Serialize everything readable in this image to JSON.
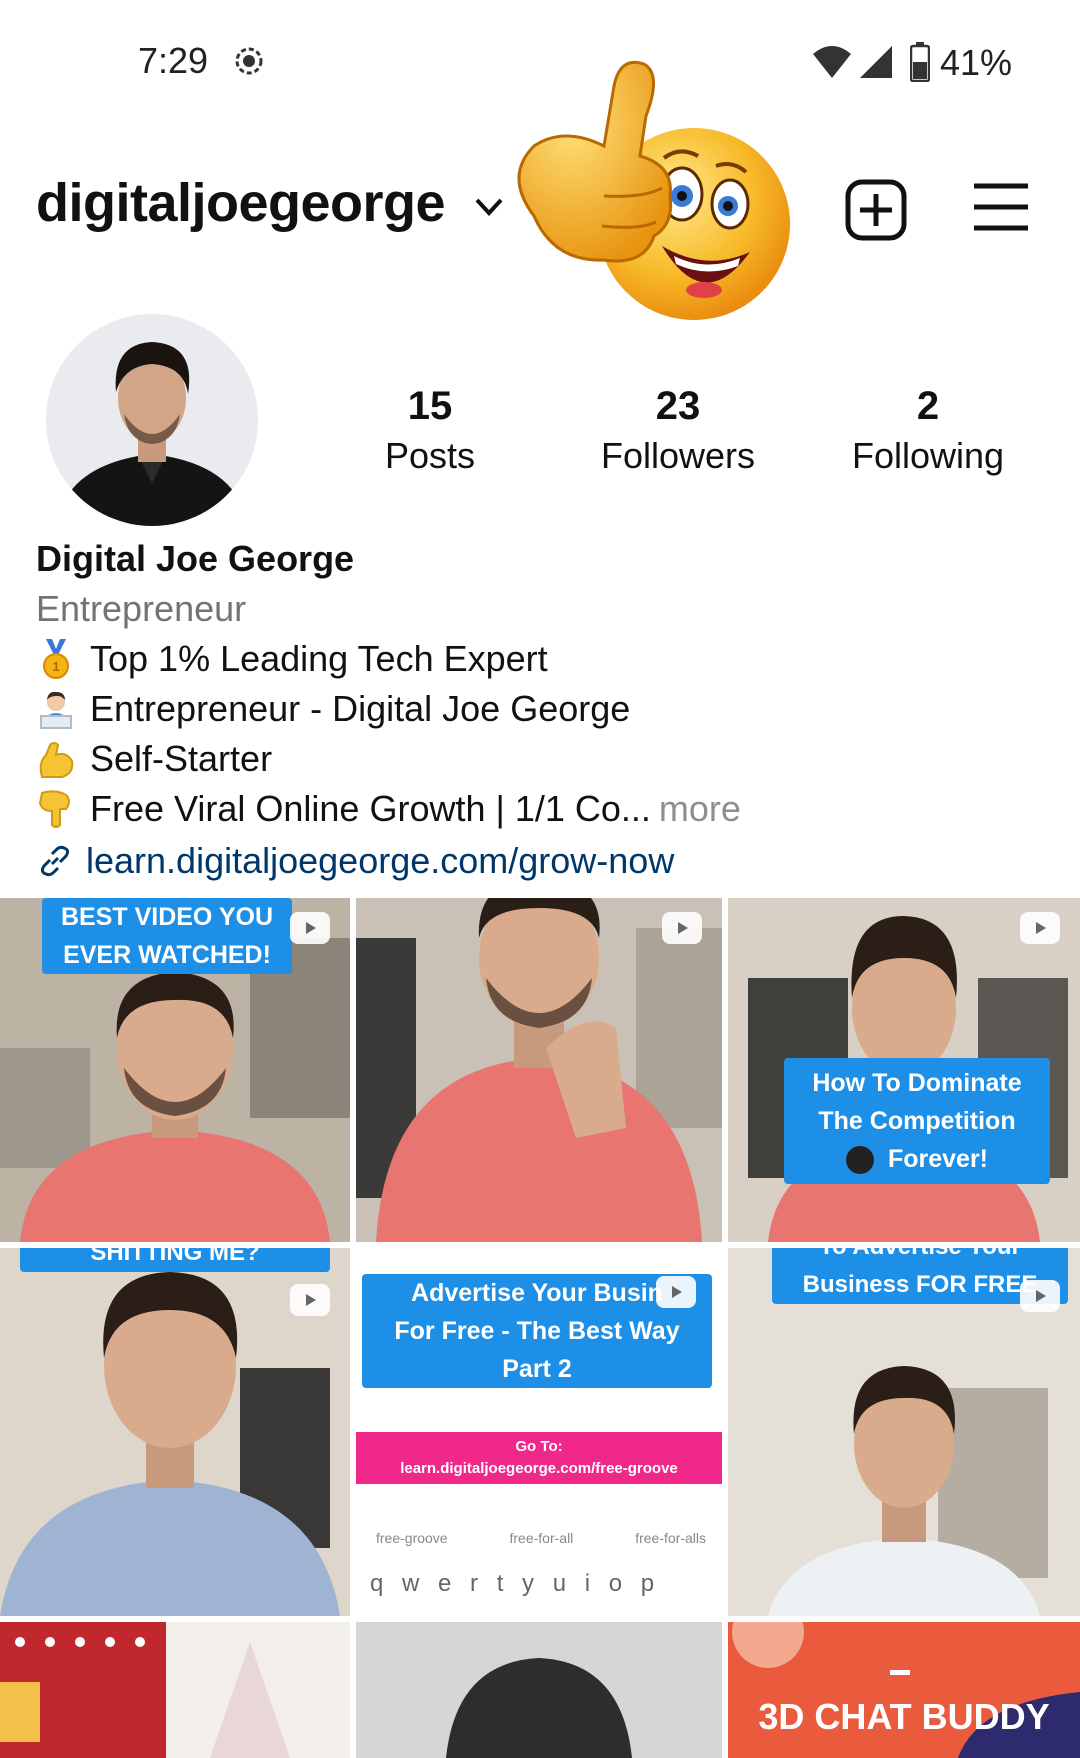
{
  "status_bar": {
    "time": "7:29",
    "battery": "41%"
  },
  "header": {
    "username": "digitaljoegeorge"
  },
  "profile": {
    "stats": [
      {
        "value": "15",
        "label": "Posts"
      },
      {
        "value": "23",
        "label": "Followers"
      },
      {
        "value": "2",
        "label": "Following"
      }
    ],
    "name": "Digital Joe George",
    "category": "Entrepreneur",
    "bio": [
      {
        "icon": "medal-icon",
        "text": "Top 1% Leading Tech Expert"
      },
      {
        "icon": "technologist-icon",
        "text": "Entrepreneur - Digital Joe George"
      },
      {
        "icon": "flexed-biceps-icon",
        "text": "Self-Starter"
      },
      {
        "icon": "pointing-down-icon",
        "text": "Free Viral Online Growth | 1/1 Co..."
      }
    ],
    "more": "more",
    "link": "learn.digitaljoegeorge.com/grow-now"
  },
  "grid": {
    "t1_banner": [
      "BEST VIDEO YOU",
      "EVER WATCHED!"
    ],
    "t3_banner": [
      "How To Dominate",
      "The Competition",
      "Forever!"
    ],
    "t4_banner": "SHITTING ME?",
    "t5_banner": [
      "Advertise Your Busin",
      "For Free - The Best Way",
      "Part 2"
    ],
    "t5_goto": "Go To:",
    "t5_url": "learn.digitaljoegeorge.com/free-groove",
    "t5_suggest": [
      "free-groove",
      "free-for-all",
      "free-for-alls"
    ],
    "t5_keys": "q w e r t y u i o p",
    "t6_banner": [
      "To Advertise Your",
      "Business FOR FREE"
    ],
    "t9_title": "3D CHAT BUDDY"
  },
  "colors": {
    "link": "#00376b",
    "banner": "#1e8fe6",
    "shirt": "#e8756f",
    "magenta": "#f0288a"
  }
}
